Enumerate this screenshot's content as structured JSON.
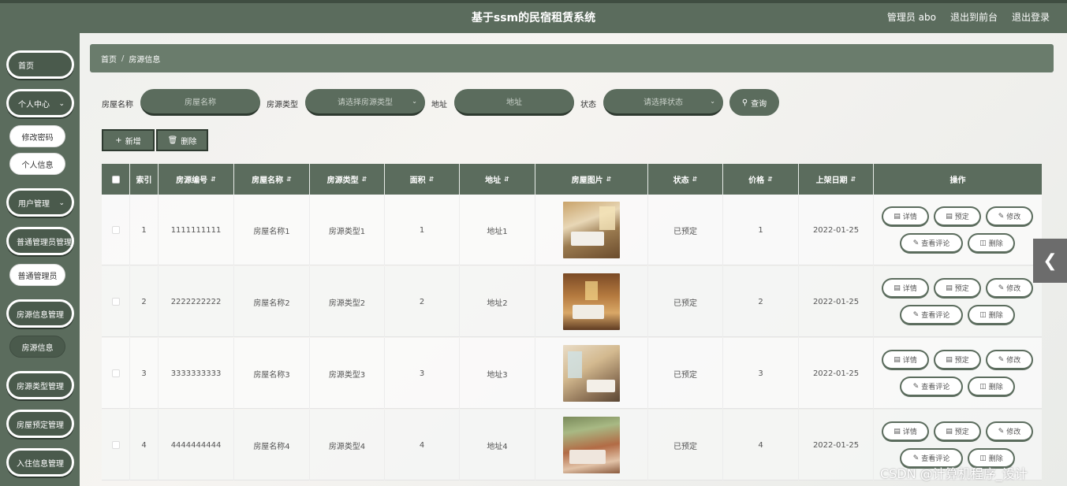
{
  "header": {
    "title": "基于ssm的民宿租赁系统",
    "user": "管理员 abo",
    "front_link": "退出到前台",
    "logout": "退出登录"
  },
  "sidebar": {
    "home": "首页",
    "personal_center": "个人中心",
    "change_password": "修改密码",
    "personal_info": "个人信息",
    "user_mgmt": "用户管理",
    "admin_mgmt": "普通管理员管理",
    "admin": "普通管理员",
    "house_info_mgmt": "房源信息管理",
    "house_info": "房源信息",
    "house_type_mgmt": "房源类型管理",
    "booking_mgmt": "房屋预定管理",
    "checkin_mgmt": "入住信息管理"
  },
  "breadcrumb": {
    "home": "首页",
    "sep": "/",
    "current": "房源信息"
  },
  "filters": {
    "name_label": "房屋名称",
    "name_placeholder": "房屋名称",
    "type_label": "房源类型",
    "type_placeholder": "请选择房源类型",
    "address_label": "地址",
    "address_placeholder": "地址",
    "status_label": "状态",
    "status_placeholder": "请选择状态",
    "search": "查询"
  },
  "actions": {
    "add": "新增",
    "delete": "删除"
  },
  "table": {
    "columns": [
      "索引",
      "房源编号",
      "房屋名称",
      "房源类型",
      "面积",
      "地址",
      "房屋图片",
      "状态",
      "价格",
      "上架日期",
      "操作"
    ],
    "rows": [
      {
        "index": "1",
        "code": "1111111111",
        "name": "房屋名称1",
        "type": "房源类型1",
        "area": "1",
        "address": "地址1",
        "status": "已预定",
        "price": "1",
        "date": "2022-01-25"
      },
      {
        "index": "2",
        "code": "2222222222",
        "name": "房屋名称2",
        "type": "房源类型2",
        "area": "2",
        "address": "地址2",
        "status": "已预定",
        "price": "2",
        "date": "2022-01-25"
      },
      {
        "index": "3",
        "code": "3333333333",
        "name": "房屋名称3",
        "type": "房源类型3",
        "area": "3",
        "address": "地址3",
        "status": "已预定",
        "price": "3",
        "date": "2022-01-25"
      },
      {
        "index": "4",
        "code": "4444444444",
        "name": "房屋名称4",
        "type": "房源类型4",
        "area": "4",
        "address": "地址4",
        "status": "已预定",
        "price": "4",
        "date": "2022-01-25"
      }
    ],
    "ops": {
      "detail": "详情",
      "book": "预定",
      "edit": "修改",
      "comments": "查看评论",
      "delete": "删除"
    }
  },
  "watermark": "CSDN @计算机程序_设计",
  "colors": {
    "primary": "#5b6c5d",
    "dark": "#2e3a30"
  }
}
